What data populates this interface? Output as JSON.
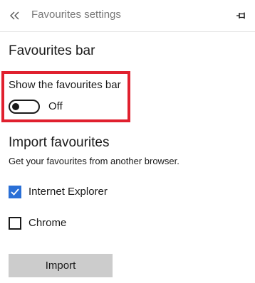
{
  "header": {
    "back_icon": "double-chevron-left-icon",
    "title": "Favourites settings",
    "pin_icon": "pin-icon"
  },
  "favourites_bar": {
    "title": "Favourites bar",
    "toggle_label": "Show the favourites bar",
    "toggle_on": false,
    "toggle_state_text": "Off",
    "highlight_color": "#e0202e"
  },
  "import": {
    "title": "Import favourites",
    "description": "Get your favourites from another browser.",
    "browsers": [
      {
        "label": "Internet Explorer",
        "checked": true
      },
      {
        "label": "Chrome",
        "checked": false
      }
    ],
    "button_label": "Import",
    "accent_color": "#2a6fd6"
  }
}
